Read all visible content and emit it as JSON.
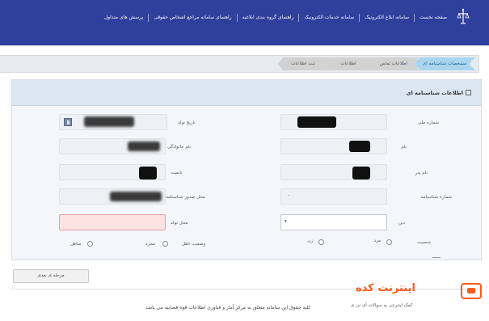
{
  "nav": {
    "items": [
      "صفحه نخست",
      "سامانه ابلاغ الکترونیک",
      "سامانه خدمات الکترونیک",
      "راهنمای گروه بندی ابلاغیه",
      "راهنمای سامانه مراجع اشخاص حقوقی",
      "پرسش های متداول"
    ]
  },
  "steps": [
    "مشخصات شناسنامه ای",
    "اطلاعات تماس",
    "اطلاعات",
    "ثبت اطلاعات"
  ],
  "panel": {
    "title": "اطلاعات شناسنامه ای"
  },
  "form": {
    "national_code_label": "شماره ملی",
    "birth_date_label": "تاریخ تولد",
    "name_label": "نام",
    "family_label": "نام خانوادگی",
    "father_label": "نام پدر",
    "nationality_label": "تابعیت",
    "id_number_label": "شماره شناسنامه",
    "issue_place_label": "محل صدور شناسنامه",
    "religion_label": "دین",
    "birth_place_label": "محل تولد",
    "gender_label": "جنسیت",
    "gender_male": "مرد",
    "gender_female": "زن",
    "marital_label": "وضعیت تاهل",
    "marital_single": "مجرد",
    "marital_married": "متاهل",
    "id_number_value": "-",
    "religion_value": "▾"
  },
  "back_button": "مرحله ی بعدی",
  "footer": "کلیه حقوق این سامانه متعلق به مرکز آمار و فناوری اطلاعات قوه قضاییه می باشد",
  "watermark": {
    "title": "اینترنت کده",
    "subtitle": "کمک اینترنتی به سوالات آی تی ی"
  }
}
